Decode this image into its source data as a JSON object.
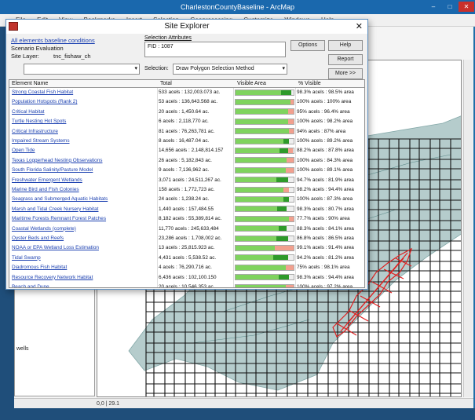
{
  "app": {
    "title": "CharlestonCountyBaseline - ArcMap",
    "menu": [
      "File",
      "Edit",
      "View",
      "Bookmarks",
      "Insert",
      "Selection",
      "Geoprocessing",
      "Customize",
      "Windows",
      "Help"
    ],
    "window_buttons": [
      "–",
      "□",
      "✕"
    ]
  },
  "status": {
    "left": "wells",
    "page": "0,0 | 29.1"
  },
  "dialog": {
    "title": "Site Explorer",
    "close": "✕",
    "link_all_elements": "All elements baseline conditions",
    "scenario_label": "Scenario Evaluation",
    "site_layer_label": "Site Layer:",
    "site_layer_value": "tnc_fishaw_ch",
    "site_dropdown_value": "",
    "selection_attributes_label": "Selection Attributes",
    "selection_attributes_value": "FID : 1087",
    "selection_label": "Selection:",
    "selection_dropdown_value": "Draw Polygon Selection Method",
    "buttons": {
      "options": "Options",
      "help": "Help",
      "report": "Report",
      "more": "More >>"
    },
    "columns": [
      "Element Name",
      "Total",
      "Visible Area",
      "% Visible"
    ],
    "rows": [
      {
        "name": "Strong Coastal Fish Habitat",
        "total": "533 acels : 132,003.073 ac.",
        "green": 0.78,
        "dark": 0.18,
        "pink": 0.0,
        "pct": "98.3% acels : 98.5% area"
      },
      {
        "name": "Population Hotspots (Rank 2)",
        "total": "53 acels : 136,643.568 ac.",
        "green": 0.95,
        "dark": 0.0,
        "pink": 0.05,
        "pct": "100% acels : 100% area"
      },
      {
        "name": "Critical Habitat",
        "total": "20 acels : 1,450.64 ac.",
        "green": 0.9,
        "dark": 0.0,
        "pink": 0.1,
        "pct": "95% acels : 96.4% area"
      },
      {
        "name": "Turtle Nesting Hot Spots",
        "total": "6 acels : 2,118,770 ac.",
        "green": 0.9,
        "dark": 0.0,
        "pink": 0.1,
        "pct": "100% acels : 98.2% area"
      },
      {
        "name": "Critical Infrastructure",
        "total": "81 acels : 76,263,781 ac.",
        "green": 0.92,
        "dark": 0.0,
        "pink": 0.08,
        "pct": "94% acels : 87% area"
      },
      {
        "name": "Impaired Stream Systems",
        "total": "8 acels : 16,487.04 ac.",
        "green": 0.82,
        "dark": 0.1,
        "pink": 0.0,
        "pct": "100% acels : 89.2% area"
      },
      {
        "name": "Open Tide",
        "total": "14,656 acels : 2,148,814.157",
        "green": 0.76,
        "dark": 0.14,
        "pink": 0.08,
        "pct": "88.2% acels : 87.8% area"
      },
      {
        "name": "Texas Loggerhead Nesting Observations",
        "total": "26 acels : 5,182,843 ac.",
        "green": 0.88,
        "dark": 0.0,
        "pink": 0.12,
        "pct": "100% acels : 84.3% area"
      },
      {
        "name": "South Florida Salinity/Pasture Model",
        "total": "9 acels : 7,136,962 ac.",
        "green": 0.86,
        "dark": 0.0,
        "pink": 0.14,
        "pct": "100% acels : 89.1% area"
      },
      {
        "name": "Freshwater Emergent Wetlands",
        "total": "3,071 acels : 24,511,267 ac.",
        "green": 0.7,
        "dark": 0.2,
        "pink": 0.0,
        "pct": "94.7% acels : 81.9% area"
      },
      {
        "name": "Marine Bird and Fish Colonies",
        "total": "158 acels : 1,772,723 ac.",
        "green": 0.82,
        "dark": 0.0,
        "pink": 0.1,
        "pct": "98.2% acels : 94.4% area"
      },
      {
        "name": "Seagrass and Submerged Aquatic Habitats",
        "total": "24 acels : 1,238.24 ac.",
        "green": 0.82,
        "dark": 0.1,
        "pink": 0.0,
        "pct": "100% acels : 87.3% area"
      },
      {
        "name": "Marsh and Tidal Creek Nursery Habitat",
        "total": "1,440 acels : 157,484.55",
        "green": 0.72,
        "dark": 0.16,
        "pink": 0.0,
        "pct": "98.3% acels : 80.7% area"
      },
      {
        "name": "Maritime Forests Remnant Forest Patches",
        "total": "8,182 acels : 55,389,814 ac.",
        "green": 0.92,
        "dark": 0.0,
        "pink": 0.08,
        "pct": "77.7% acels : 90% area"
      },
      {
        "name": "Coastal Wetlands (complete)",
        "total": "11,770 acels : 245,633,484",
        "green": 0.74,
        "dark": 0.14,
        "pink": 0.0,
        "pct": "88.3% acels : 84.1% area"
      },
      {
        "name": "Oyster Beds and Reefs",
        "total": "23,286 acels : 1,708,002 ac.",
        "green": 0.7,
        "dark": 0.2,
        "pink": 0.0,
        "pct": "86.8% acels : 86.5% area"
      },
      {
        "name": "NOAA or EPA Wetland Loss Estimation",
        "total": "13 acels : 25,815.923 ac.",
        "green": 0.68,
        "dark": 0.0,
        "pink": 0.32,
        "pct": "99.1% acels : 91.4% area"
      },
      {
        "name": "Tidal Swamp",
        "total": "4,431 acels : 5,538.52 ac.",
        "green": 0.65,
        "dark": 0.26,
        "pink": 0.0,
        "pct": "94.2% acels : 81.2% area"
      },
      {
        "name": "Diadromous Fish Habitat",
        "total": "4 acels : 76,290,716 ac.",
        "green": 0.86,
        "dark": 0.0,
        "pink": 0.14,
        "pct": "75% acels : 98.1% area"
      },
      {
        "name": "Resource Recovery Network Habitat",
        "total": "6,436 acels : 102,100.150",
        "green": 0.74,
        "dark": 0.18,
        "pink": 0.0,
        "pct": "98.3% acels : 94.4% area"
      },
      {
        "name": "Beach and Dune",
        "total": "20 acels : 10,546,353 ac.",
        "green": 0.86,
        "dark": 0.0,
        "pink": 0.14,
        "pct": "100% acels : 97.2% area"
      }
    ]
  },
  "colors": {
    "accent": "#1a68ad",
    "bar_green": "#7fd35e",
    "bar_dark": "#2e9a2a",
    "bar_pink": "#f2a08e",
    "selection_red": "#e02020",
    "land": "#7aa6a6"
  }
}
